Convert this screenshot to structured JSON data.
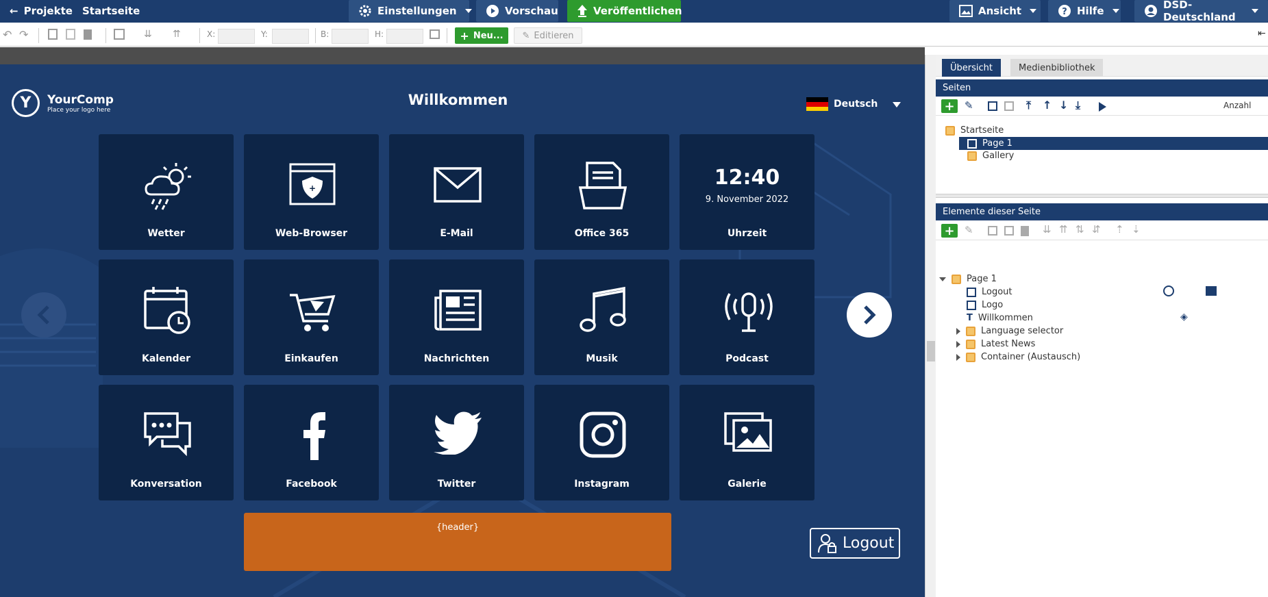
{
  "topbar": {
    "back_label": "Projekte",
    "page_label": "Startseite",
    "settings_label": "Einstellungen",
    "preview_label": "Vorschau",
    "publish_label": "Veröffentlichen",
    "view_label": "Ansicht",
    "help_label": "Hilfe",
    "account_label": "DSD-Deutschland"
  },
  "toolbar": {
    "x_label": "X:",
    "y_label": "Y:",
    "w_label": "B:",
    "h_label": "H:",
    "new_label": "Neu...",
    "edit_label": "Editieren"
  },
  "canvas": {
    "company_name": "YourComp",
    "company_tagline": "Place your logo here",
    "logo_letter": "Y",
    "title": "Willkommen",
    "language": "Deutsch",
    "clock_time": "12:40",
    "clock_date": "9. November 2022",
    "tiles": [
      "Wetter",
      "Web-Browser",
      "E-Mail",
      "Office 365",
      "Uhrzeit",
      "Kalender",
      "Einkaufen",
      "Nachrichten",
      "Musik",
      "Podcast",
      "Konversation",
      "Facebook",
      "Twitter",
      "Instagram",
      "Galerie"
    ],
    "header_placeholder": "{header}",
    "logout_label": "Logout"
  },
  "panel": {
    "tab_overview": "Übersicht",
    "tab_media": "Medienbibliothek",
    "pages_header": "Seiten",
    "count_label": "Anzahl",
    "pages": [
      "Startseite",
      "Page 1",
      "Gallery"
    ],
    "elements_header": "Elemente dieser Seite",
    "elements_root": "Page 1",
    "elements": [
      "Logout",
      "Logo",
      "Willkommen",
      "Language selector",
      "Latest News",
      "Container (Austausch)"
    ]
  },
  "colors": {
    "brand_dark": "#1c3d6e",
    "canvas_bg": "#1d3d6d",
    "tile_bg": "#0d2547",
    "publish_green": "#2e9b2e",
    "header_orange": "#c8651b"
  }
}
